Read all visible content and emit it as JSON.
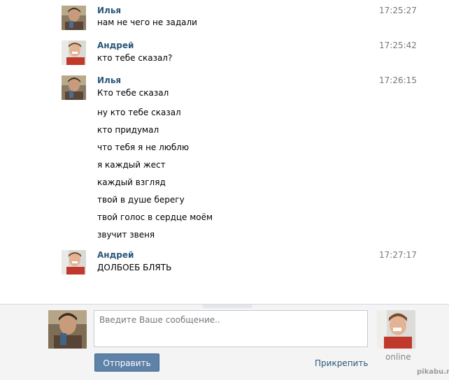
{
  "messages": [
    {
      "author": "Илья",
      "time": "17:25:27",
      "lines": [
        "нам не чего не задали"
      ],
      "avatar": "ilya-photo"
    },
    {
      "author": "Андрей",
      "time": "17:25:42",
      "lines": [
        "кто тебе сказал?"
      ],
      "avatar": "andrey-photo"
    },
    {
      "author": "Илья",
      "time": "17:26:15",
      "lines": [
        "Кто тебе сказал",
        "ну кто тебе сказал",
        "кто придумал",
        "что тебя я не люблю",
        "я каждый жест",
        "каждый взгляд",
        "твой в душе берегу",
        "твой голос в сердце моём",
        "звучит звеня"
      ],
      "avatar": "ilya-photo"
    },
    {
      "author": "Андрей",
      "time": "17:27:17",
      "lines": [
        "ДОЛБОЕБ БЛЯТЬ"
      ],
      "avatar": "andrey-photo"
    }
  ],
  "compose": {
    "placeholder": "Введите Ваше сообщение..",
    "value": "",
    "send_label": "Отправить",
    "attach_label": "Прикрепить",
    "status": "online"
  },
  "watermark": "pikabu.ru",
  "colors": {
    "author_link": "#2b587a",
    "send_button": "#5e82a8",
    "compose_bg": "#f4f4f4"
  }
}
